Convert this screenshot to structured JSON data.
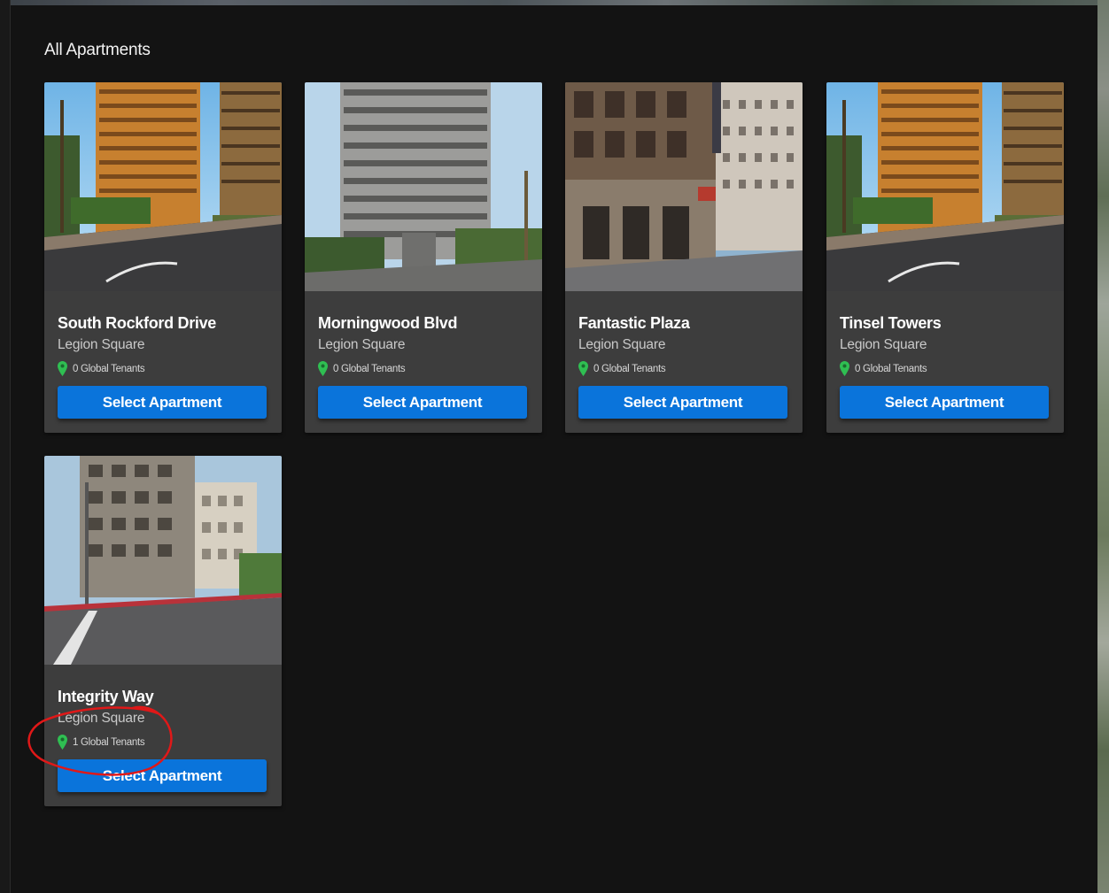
{
  "page": {
    "heading": "All Apartments"
  },
  "apartments": [
    {
      "name": "South Rockford Drive",
      "area": "Legion Square",
      "tenants": "0 Global Tenants",
      "button": "Select Apartment"
    },
    {
      "name": "Morningwood Blvd",
      "area": "Legion Square",
      "tenants": "0 Global Tenants",
      "button": "Select Apartment"
    },
    {
      "name": "Fantastic Plaza",
      "area": "Legion Square",
      "tenants": "0 Global Tenants",
      "button": "Select Apartment"
    },
    {
      "name": "Tinsel Towers",
      "area": "Legion Square",
      "tenants": "0 Global Tenants",
      "button": "Select Apartment"
    },
    {
      "name": "Integrity Way",
      "area": "Legion Square",
      "tenants": "1 Global Tenants",
      "button": "Select Apartment"
    }
  ],
  "colors": {
    "panel": "#131313",
    "card": "#3d3d3d",
    "button": "#0a74db",
    "pin": "#2fbf52",
    "annotation": "#e01818"
  },
  "icons": {
    "tenant_icon": "map-pin-icon"
  }
}
